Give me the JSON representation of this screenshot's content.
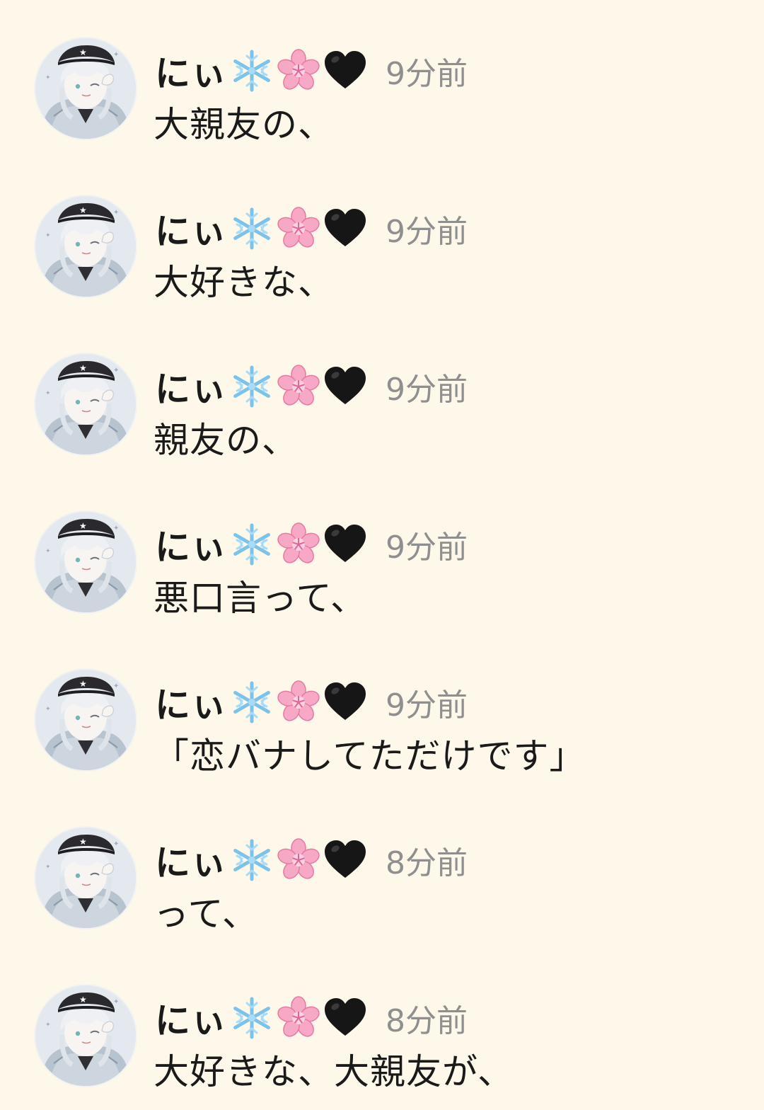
{
  "colors": {
    "background": "#fdf8ea",
    "text": "#1a1a1a",
    "timestamp": "#8f8f8f"
  },
  "messages": [
    {
      "username": "にぃ",
      "badges": [
        "snowflake-icon",
        "cherry-blossom-icon",
        "black-heart-icon"
      ],
      "timestamp": "9分前",
      "text": "大親友の、"
    },
    {
      "username": "にぃ",
      "badges": [
        "snowflake-icon",
        "cherry-blossom-icon",
        "black-heart-icon"
      ],
      "timestamp": "9分前",
      "text": "大好きな、"
    },
    {
      "username": "にぃ",
      "badges": [
        "snowflake-icon",
        "cherry-blossom-icon",
        "black-heart-icon"
      ],
      "timestamp": "9分前",
      "text": "親友の、"
    },
    {
      "username": "にぃ",
      "badges": [
        "snowflake-icon",
        "cherry-blossom-icon",
        "black-heart-icon"
      ],
      "timestamp": "9分前",
      "text": "悪口言って、"
    },
    {
      "username": "にぃ",
      "badges": [
        "snowflake-icon",
        "cherry-blossom-icon",
        "black-heart-icon"
      ],
      "timestamp": "9分前",
      "text": "「恋バナしてただけです」"
    },
    {
      "username": "にぃ",
      "badges": [
        "snowflake-icon",
        "cherry-blossom-icon",
        "black-heart-icon"
      ],
      "timestamp": "8分前",
      "text": "って、"
    },
    {
      "username": "にぃ",
      "badges": [
        "snowflake-icon",
        "cherry-blossom-icon",
        "black-heart-icon"
      ],
      "timestamp": "8分前",
      "text": "大好きな、大親友が、"
    }
  ]
}
